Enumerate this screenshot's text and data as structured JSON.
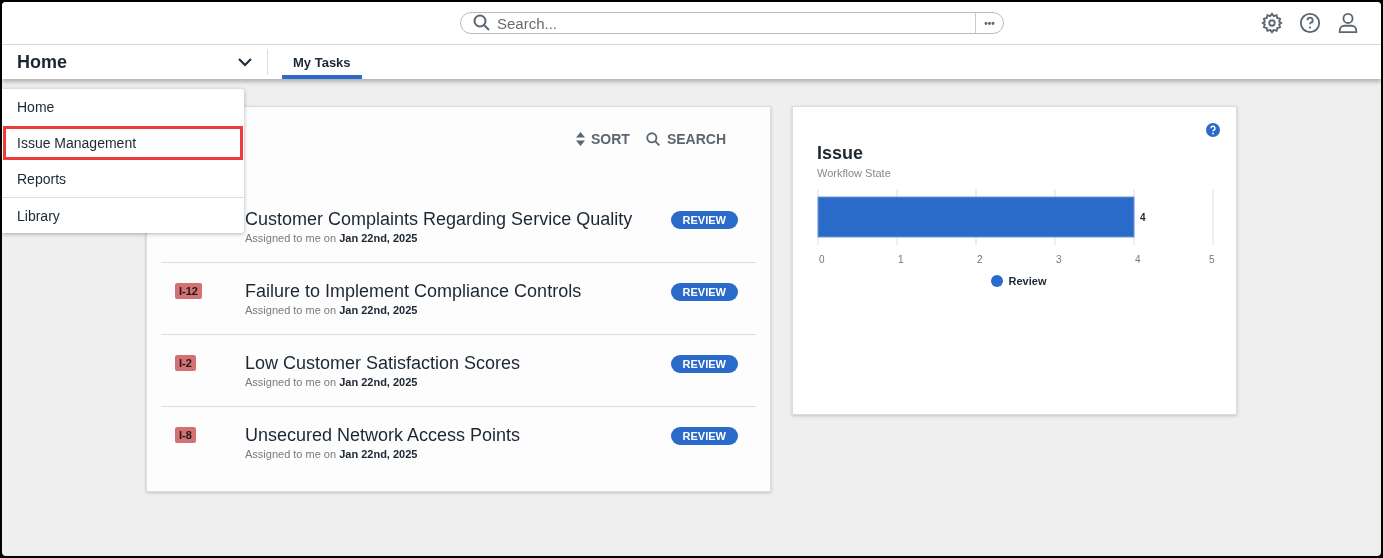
{
  "top_bar": {
    "search": {
      "placeholder": "Search..."
    },
    "more_button": "•••"
  },
  "nav": {
    "module": "Home",
    "tabs": [
      {
        "label": "My Tasks",
        "selected": true
      }
    ]
  },
  "module_menu": {
    "items": [
      {
        "label": "Home",
        "highlighted": false,
        "divider_before": false
      },
      {
        "label": "Issue Management",
        "highlighted": true,
        "divider_before": false
      },
      {
        "label": "Reports",
        "highlighted": false,
        "divider_before": false
      },
      {
        "label": "Library",
        "highlighted": false,
        "divider_before": true
      }
    ]
  },
  "tasks_card": {
    "sort": "SORT",
    "search": "SEARCH",
    "rows": [
      {
        "title": "Customer Complaints Regarding Service Quality",
        "assigned": "Assigned to me on",
        "date": "Jan 22nd, 2025",
        "status": "REVIEW"
      },
      {
        "id": "I-12",
        "title": "Failure to Implement Compliance Controls",
        "assigned": "Assigned to me on",
        "date": "Jan 22nd, 2025",
        "status": "REVIEW"
      },
      {
        "id": "I-2",
        "title": "Low Customer Satisfaction Scores",
        "assigned": "Assigned to me on",
        "date": "Jan 22nd, 2025",
        "status": "REVIEW"
      },
      {
        "id": "I-8",
        "title": "Unsecured Network Access Points",
        "assigned": "Assigned to me on",
        "date": "Jan 22nd, 2025",
        "status": "REVIEW"
      }
    ]
  },
  "chart_card": {
    "title": "Issue",
    "subtitle": "Workflow State",
    "chart_data": {
      "type": "bar",
      "orientation": "horizontal",
      "grid": true,
      "series": [
        {
          "name": "Review",
          "color": "#2a6ac8",
          "values": [
            4
          ]
        }
      ],
      "xlim": [
        0,
        5
      ],
      "xticks": [
        0,
        1,
        2,
        3,
        4,
        5
      ],
      "data_labels": true
    }
  }
}
